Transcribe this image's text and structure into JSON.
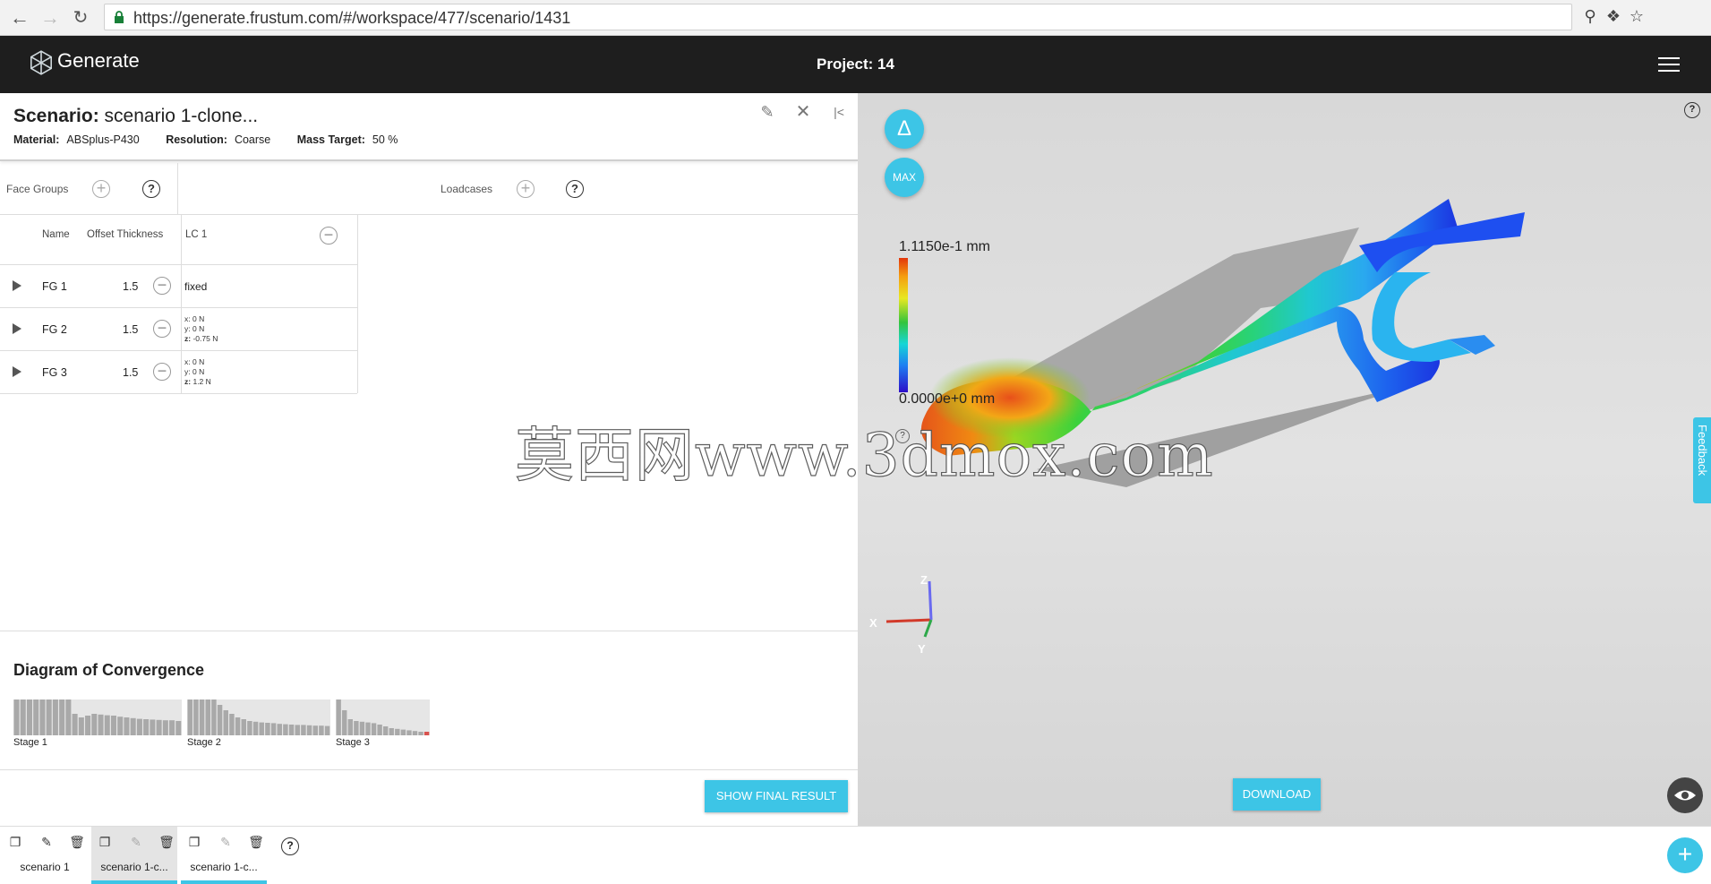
{
  "browser": {
    "url": "https://generate.frustum.com/#/workspace/477/scenario/1431",
    "back_icon": "arrow-left-icon",
    "forward_icon": "arrow-right-icon",
    "reload_icon": "reload-icon"
  },
  "header": {
    "logo_text": "Generate",
    "project_title": "Project: 14"
  },
  "scenario": {
    "title_label": "Scenario:",
    "title_value": "scenario 1-clone...",
    "material_label": "Material:",
    "material_value": "ABSplus-P430",
    "resolution_label": "Resolution:",
    "resolution_value": "Coarse",
    "mass_label": "Mass Target:",
    "mass_value": "50 %"
  },
  "subheader": {
    "face_groups": "Face Groups",
    "loadcases": "Loadcases"
  },
  "table": {
    "col_name": "Name",
    "col_offset": "Offset Thickness",
    "col_lc": "LC 1",
    "rows": [
      {
        "name": "FG 1",
        "thickness": "1.5",
        "lc": "fixed"
      },
      {
        "name": "FG 2",
        "thickness": "1.5",
        "fx": "0 N",
        "fy": "0 N",
        "fz": "-0.75 N"
      },
      {
        "name": "FG 3",
        "thickness": "1.5",
        "fx": "0 N",
        "fy": "0 N",
        "fz": "1.2 N"
      }
    ],
    "x_label": "x:",
    "y_label": "y:",
    "z_label": "z:"
  },
  "convergence": {
    "title": "Diagram of Convergence",
    "stages": [
      {
        "label": "Stage 1",
        "values": [
          1,
          1,
          1,
          1,
          1,
          1,
          1,
          1,
          1,
          0.6,
          0.5,
          0.55,
          0.6,
          0.58,
          0.56,
          0.55,
          0.52,
          0.5,
          0.48,
          0.46,
          0.45,
          0.44,
          0.43,
          0.42,
          0.42,
          0.4
        ]
      },
      {
        "label": "Stage 2",
        "values": [
          1,
          1,
          1,
          1,
          1,
          0.85,
          0.7,
          0.6,
          0.5,
          0.45,
          0.4,
          0.38,
          0.36,
          0.35,
          0.34,
          0.32,
          0.31,
          0.3,
          0.29,
          0.29,
          0.28,
          0.27,
          0.27,
          0.26
        ]
      },
      {
        "label": "Stage 3",
        "values": [
          1,
          0.7,
          0.45,
          0.4,
          0.38,
          0.36,
          0.34,
          0.3,
          0.25,
          0.2,
          0.18,
          0.16,
          0.14,
          0.12,
          0.1,
          0.1
        ]
      }
    ],
    "show_final_label": "SHOW FINAL RESULT"
  },
  "viewport": {
    "delta_label": "Δ",
    "max_label": "MAX",
    "legend_max": "1.1150e-1 mm",
    "legend_min": "0.0000e+0 mm",
    "download_label": "DOWNLOAD",
    "feedback_label": "Feedback",
    "axis_x": "X",
    "axis_y": "Y",
    "axis_z": "Z",
    "help": "?"
  },
  "watermark": "莫西网www.3dmox.com",
  "tabs": [
    {
      "label": "scenario 1",
      "active": false
    },
    {
      "label": "scenario 1-c...",
      "active": true
    },
    {
      "label": "scenario 1-c...",
      "active": false
    }
  ],
  "colors": {
    "accent": "#3dc5e6",
    "header_bg": "#1e1e1e"
  }
}
